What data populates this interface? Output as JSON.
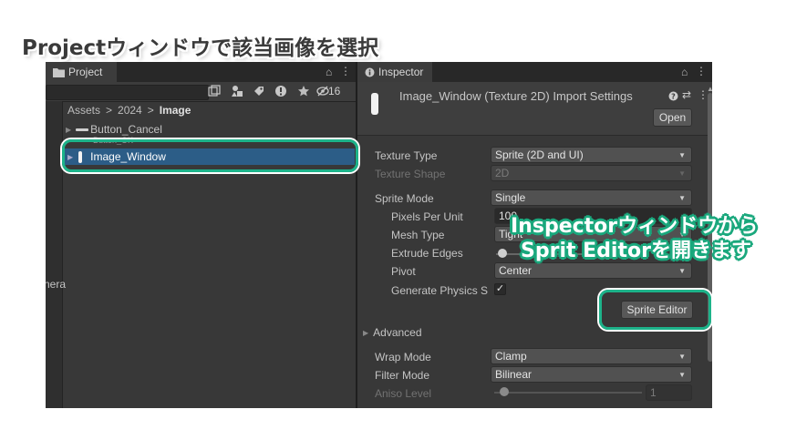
{
  "heading": "Projectウィンドウで該当画像を選択",
  "project": {
    "tab_label": "Project",
    "hidden_count": "16",
    "breadcrumb": {
      "root": "Assets",
      "sep": ">",
      "folder": "2024",
      "current": "Image"
    },
    "items": [
      {
        "label": "Button_Cancel"
      },
      {
        "label": "Button_OK"
      },
      {
        "label": "Image_Window"
      }
    ],
    "left_partial_text": "nera"
  },
  "inspector": {
    "tab_label": "Inspector",
    "asset_title": "Image_Window (Texture 2D) Import Settings",
    "open_label": "Open",
    "fields": {
      "texture_type": {
        "label": "Texture Type",
        "value": "Sprite (2D and UI)"
      },
      "texture_shape": {
        "label": "Texture Shape",
        "value": "2D"
      },
      "sprite_mode": {
        "label": "Sprite Mode",
        "value": "Single"
      },
      "pixels_per_unit": {
        "label": "Pixels Per Unit",
        "value": "100"
      },
      "mesh_type": {
        "label": "Mesh Type",
        "value": "Tight"
      },
      "extrude_edges": {
        "label": "Extrude Edges"
      },
      "pivot": {
        "label": "Pivot",
        "value": "Center"
      },
      "generate_physics": {
        "label": "Generate Physics S",
        "checked": true
      }
    },
    "sprite_editor_label": "Sprite Editor",
    "advanced_label": "Advanced",
    "wrap_mode": {
      "label": "Wrap Mode",
      "value": "Clamp"
    },
    "filter_mode": {
      "label": "Filter Mode",
      "value": "Bilinear"
    },
    "aniso_level": {
      "label": "Aniso Level",
      "value": "1"
    }
  },
  "callout": {
    "line1": "Inspectorウィンドウから",
    "line2": "Sprit Editorを開きます"
  },
  "colors": {
    "highlight": "#1db38a",
    "selection": "#2c5d87",
    "panel_bg": "#383838"
  }
}
